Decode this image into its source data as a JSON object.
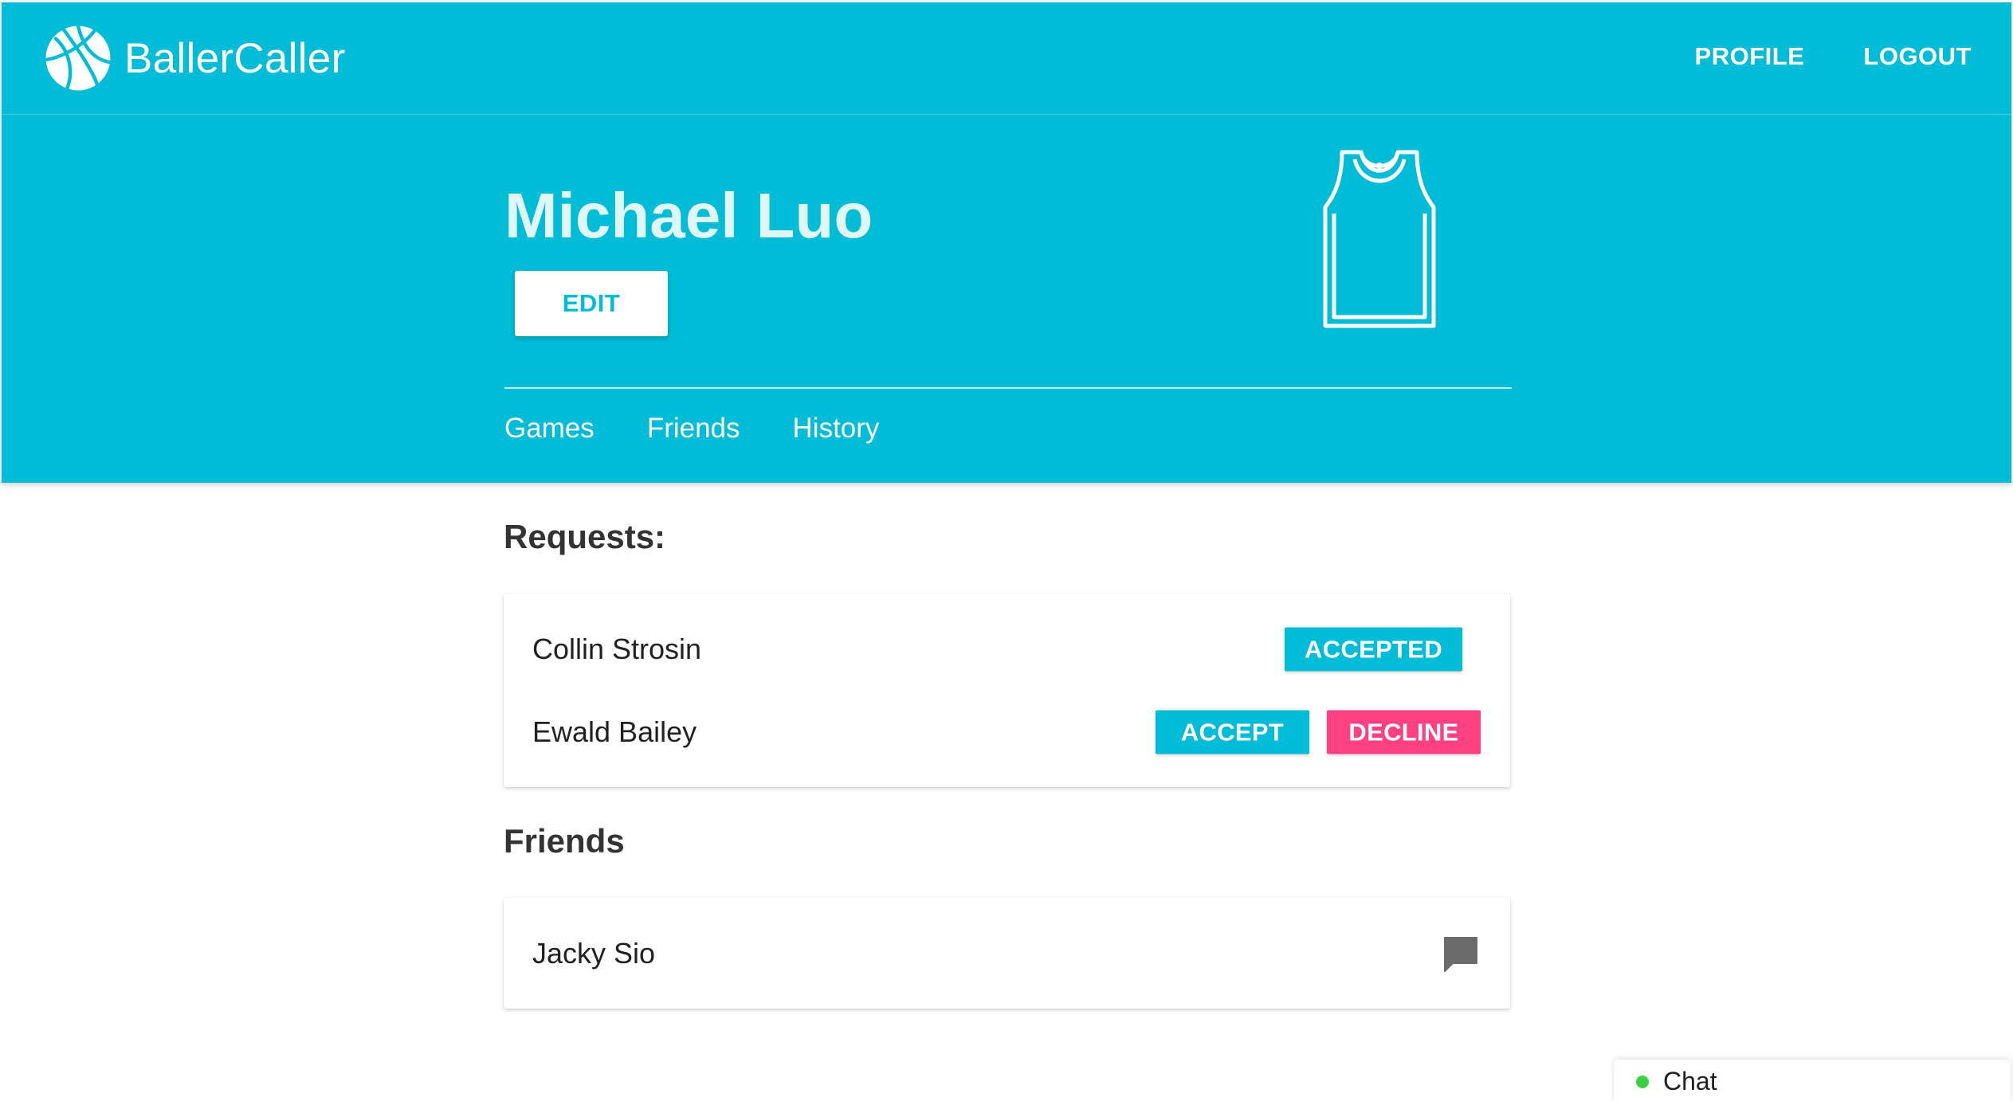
{
  "app": {
    "brand_name": "BallerCaller",
    "logo_icon": "basketball-icon"
  },
  "nav": {
    "profile_label": "PROFILE",
    "logout_label": "LOGOUT"
  },
  "profile": {
    "name": "Michael Luo",
    "edit_label": "EDIT",
    "avatar_icon": "jersey-icon"
  },
  "tabs": [
    {
      "label": "Games"
    },
    {
      "label": "Friends"
    },
    {
      "label": "History"
    }
  ],
  "requests": {
    "title": "Requests:",
    "items": [
      {
        "name": "Collin Strosin",
        "status_label": "ACCEPTED"
      },
      {
        "name": "Ewald Bailey",
        "accept_label": "ACCEPT",
        "decline_label": "DECLINE"
      }
    ]
  },
  "friends": {
    "title": "Friends",
    "items": [
      {
        "name": "Jacky Sio",
        "action_icon": "message-icon"
      }
    ]
  },
  "chat": {
    "label": "Chat",
    "status": "online"
  },
  "colors": {
    "primary": "#00bcd6",
    "accent": "#ff4081",
    "online": "#3bd140"
  }
}
